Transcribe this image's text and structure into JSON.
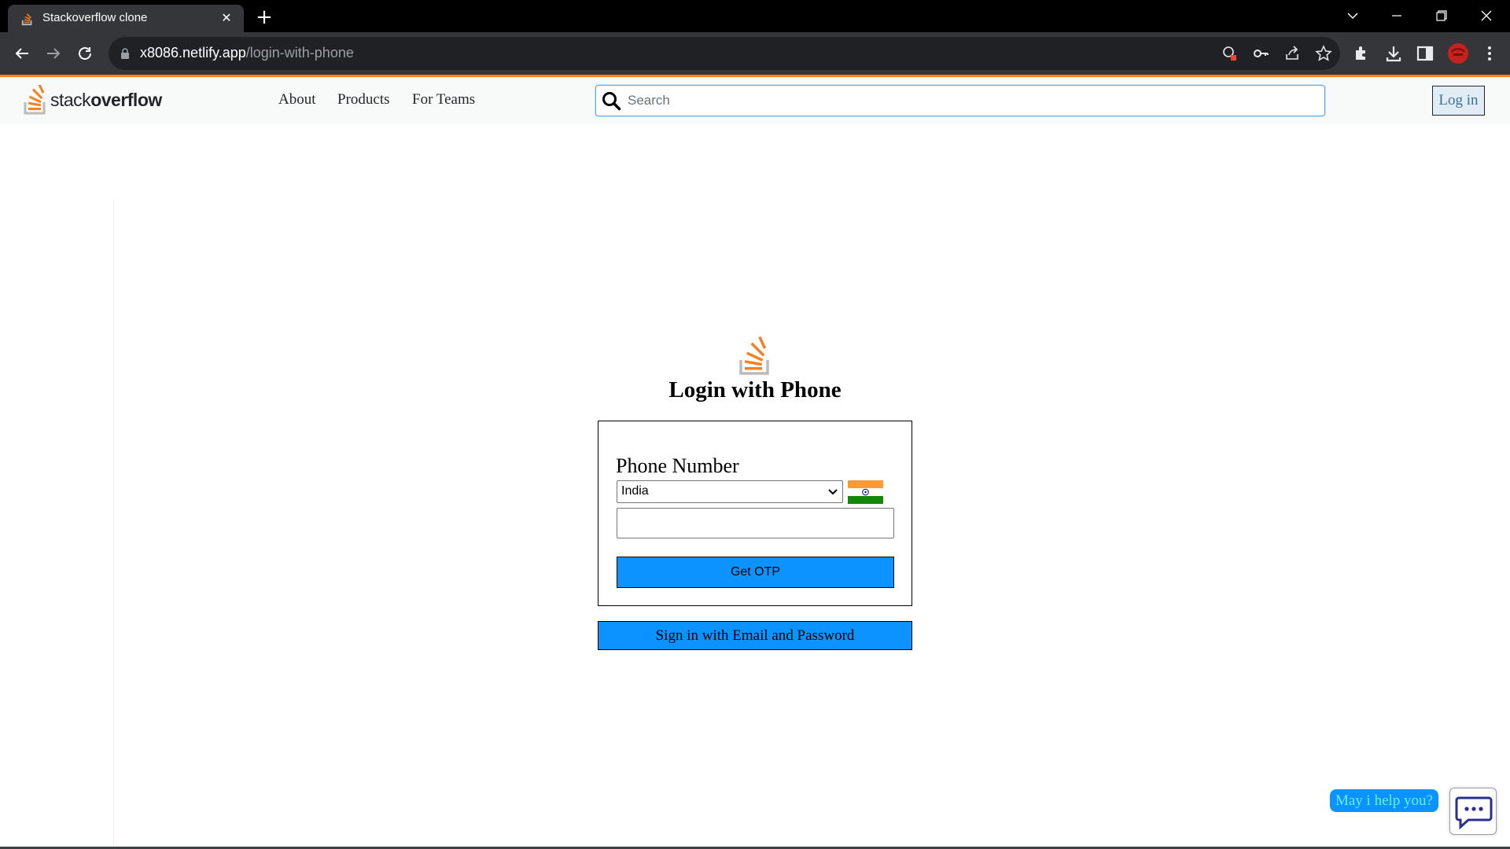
{
  "browser": {
    "tab_title": "Stackoverflow clone",
    "tab_close_glyph": "✕",
    "new_tab_glyph": "+",
    "url_host": "x8086.netlify.app",
    "url_path": "/login-with-phone"
  },
  "header": {
    "logo_light": "stack",
    "logo_bold": "overflow",
    "nav": {
      "about": "About",
      "products": "Products",
      "teams": "For Teams"
    },
    "search_placeholder": "Search",
    "login_label": "Log in"
  },
  "main": {
    "title": "Login with Phone",
    "phone_label": "Phone Number",
    "country_selected": "India",
    "get_otp_label": "Get OTP",
    "email_signin_label": "Sign in with Email and Password"
  },
  "chat": {
    "bubble_text": "May i help you?"
  },
  "colors": {
    "accent_orange": "#f48024",
    "primary_blue": "#0c93ff",
    "chat_text": "#67f0ff",
    "login_btn_bg": "#e1ecf4",
    "login_btn_text": "#39739d"
  },
  "icons": {
    "favicon": "stackoverflow-logo-icon",
    "nav": [
      "back-arrow-icon",
      "forward-arrow-icon",
      "reload-icon"
    ],
    "omnibox": [
      "lock-icon",
      "tracking-blocked-icon",
      "key-icon",
      "share-icon",
      "star-icon"
    ],
    "toolbar": [
      "extensions-icon",
      "download-icon",
      "sidepanel-icon",
      "profile-avatar",
      "kebab-menu-icon"
    ],
    "window": [
      "tab-search-icon",
      "minimize-icon",
      "restore-icon",
      "close-window-icon"
    ],
    "page": [
      "search-icon",
      "chevron-down-icon",
      "india-flag-icon",
      "chat-icon"
    ]
  }
}
